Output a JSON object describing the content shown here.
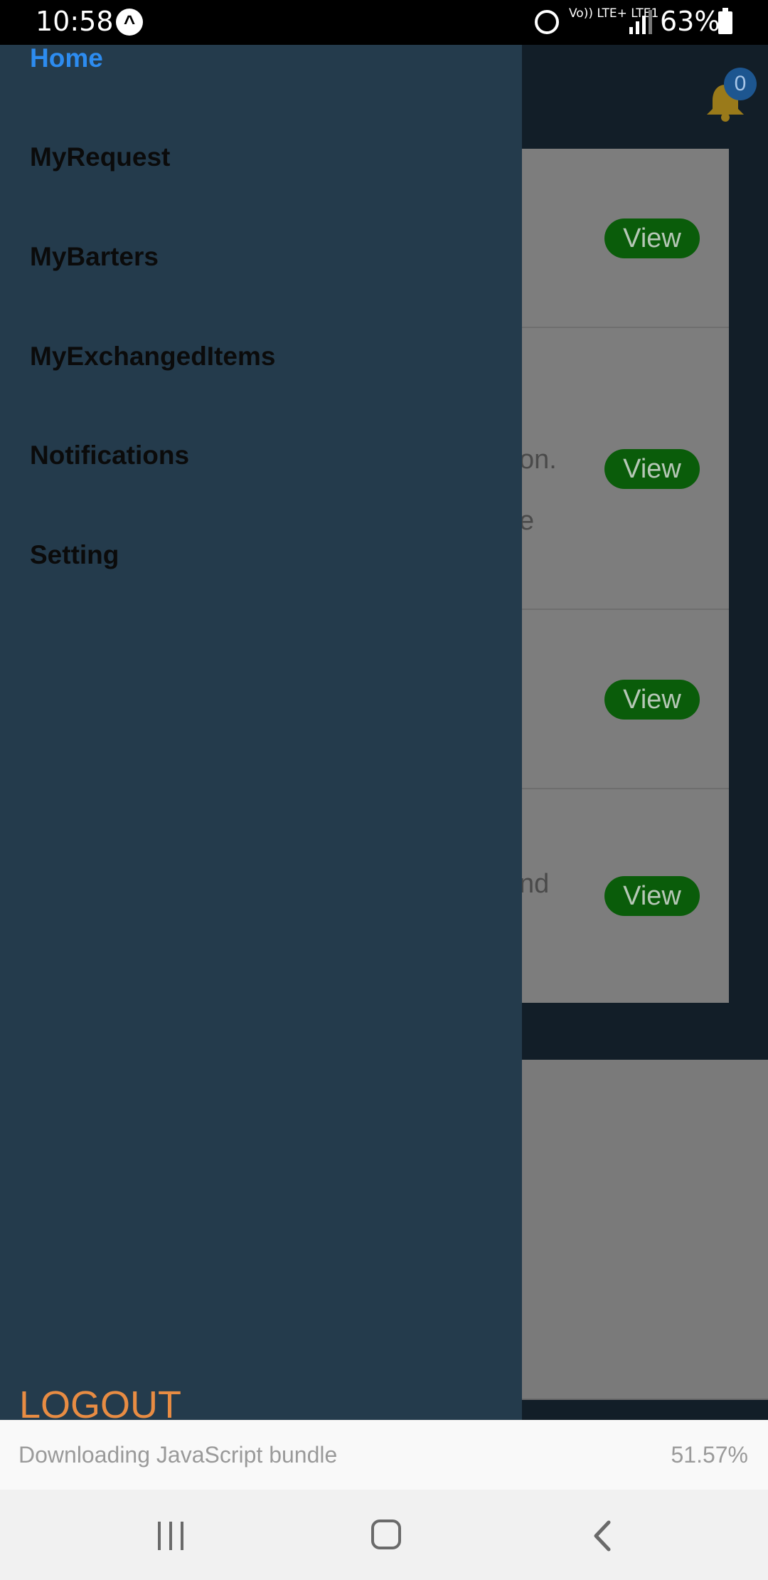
{
  "status_bar": {
    "time": "10:58",
    "notification_glyph": "^",
    "network": "Vo)) LTE+ LTE1",
    "battery_pct": "63%"
  },
  "app": {
    "notification_count": "0",
    "cards": [
      {
        "text": "",
        "button": "View"
      },
      {
        "text": "on.",
        "text2": "e",
        "button": "View"
      },
      {
        "text": "",
        "button": "View"
      },
      {
        "text": "nd",
        "button": "View"
      }
    ]
  },
  "drawer": {
    "items": [
      {
        "label": "Home",
        "active": true
      },
      {
        "label": "MyRequest"
      },
      {
        "label": "MyBarters"
      },
      {
        "label": "MyExchangedItems"
      },
      {
        "label": "Notifications"
      },
      {
        "label": "Setting"
      }
    ],
    "logout_label": "LOGOUT"
  },
  "download_banner": {
    "text": "Downloading JavaScript bundle",
    "percent": "51.57%"
  },
  "colors": {
    "drawer_bg": "#243b4c",
    "active_item": "#2d8cf0",
    "logout": "#e88c43",
    "view_button": "#0a5c0a"
  }
}
